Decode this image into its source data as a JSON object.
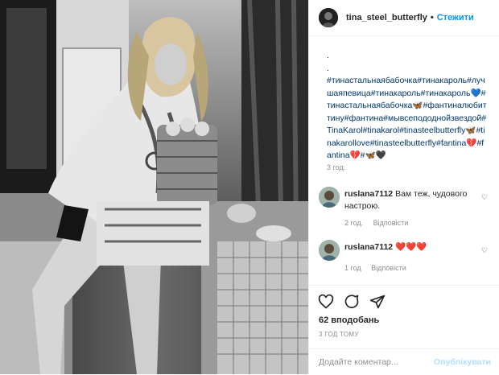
{
  "post": {
    "username": "tina_steel_butterfly",
    "separator": "•",
    "follow_label": "Стежити",
    "caption_dots": [
      ".",
      "."
    ],
    "caption_text": "#тинастальнаябабочка#тинакароль#лучшаяпевица#тинакароль#тинакароль💙#тинастальнаябабочка🦋#фантиналюбиттину#фантина#мывсепододнойзвездой#TinaKarol#tinakarol#tinasteelbutterfly🦋#tinakarollove#tinasteelbutterfly#fantina💔#fantina💔#🦋🖤",
    "time": "3 год."
  },
  "comments": [
    {
      "user": "ruslana7112",
      "text": "Вам теж, чудового настрою.",
      "time": "2 год.",
      "reply": "Відповісти"
    },
    {
      "user": "ruslana7112",
      "text": "❤️❤️❤️",
      "time": "1 год",
      "reply": "Відповісти"
    }
  ],
  "actions": {
    "like_icon": "heart-icon",
    "comment_icon": "comment-icon",
    "share_icon": "share-icon"
  },
  "likes": "62 вподобань",
  "ago": "3 ГОД ТОМУ",
  "add_comment": {
    "placeholder": "Додайте коментар...",
    "publish": "Опублікувати"
  },
  "colors": {
    "link": "#00376b",
    "follow": "#0095f6",
    "muted": "#8e8e8e"
  }
}
